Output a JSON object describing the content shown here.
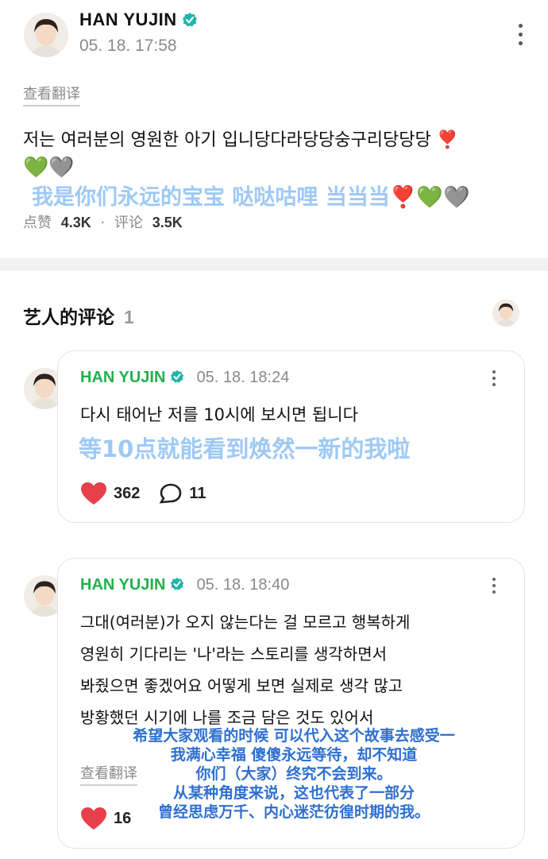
{
  "post": {
    "author": "HAN YUJIN",
    "timestamp": "05. 18. 17:58",
    "translate_label": "查看翻译",
    "body_ko": "저는 여러분의 영원한 아기 입니당다라당당숭구리당당당 ❣️",
    "body_hearts": "💚🩶",
    "subtitle_cn": "我是你们永远的宝宝 哒哒咕哩 当当当❣️💚🩶",
    "likes_label": "点赞",
    "likes_count": "4.3K",
    "separator": "·",
    "comments_label": "评论",
    "comments_count": "3.5K"
  },
  "artist_section": {
    "title": "艺人的评论",
    "count": "1"
  },
  "comments": [
    {
      "author": "HAN YUJIN",
      "timestamp": "05. 18. 18:24",
      "text": "다시 태어난 저를 10시에 보시면 됩니다",
      "subtitle_cn": "等10点就能看到焕然一新的我啦",
      "likes": "362",
      "replies": "11"
    },
    {
      "author": "HAN YUJIN",
      "timestamp": "05. 18. 18:40",
      "lines": [
        "그대(여러분)가 오지 않는다는 걸 모르고 행복하게",
        "영원히 기다리는 '나'라는 스토리를 생각하면서",
        "봐줬으면 좋겠어요 어떻게 보면 실제로 생각 많고",
        "방황했던 시기에 나를 조금 담은 것도 있어서"
      ],
      "translate_label": "查看翻译",
      "likes_partial": "16",
      "subtitle_cn_lines": [
        "希望大家观看的时候 可以代入这个故事去感受一",
        "我满心幸福 傻傻永远等待，却不知道",
        "你们（大家）终究不会到来。",
        "从某种角度来说，这也代表了一部分",
        "曾经思虑万千、内心迷茫彷徨时期的我。"
      ]
    }
  ],
  "colors": {
    "brand_green": "#22b14c",
    "verified_teal": "#21b5a8",
    "heart_red": "#e8404a",
    "subtitle_light_blue": "#9ec9f5",
    "subtitle_blue": "#2f6fd0"
  }
}
